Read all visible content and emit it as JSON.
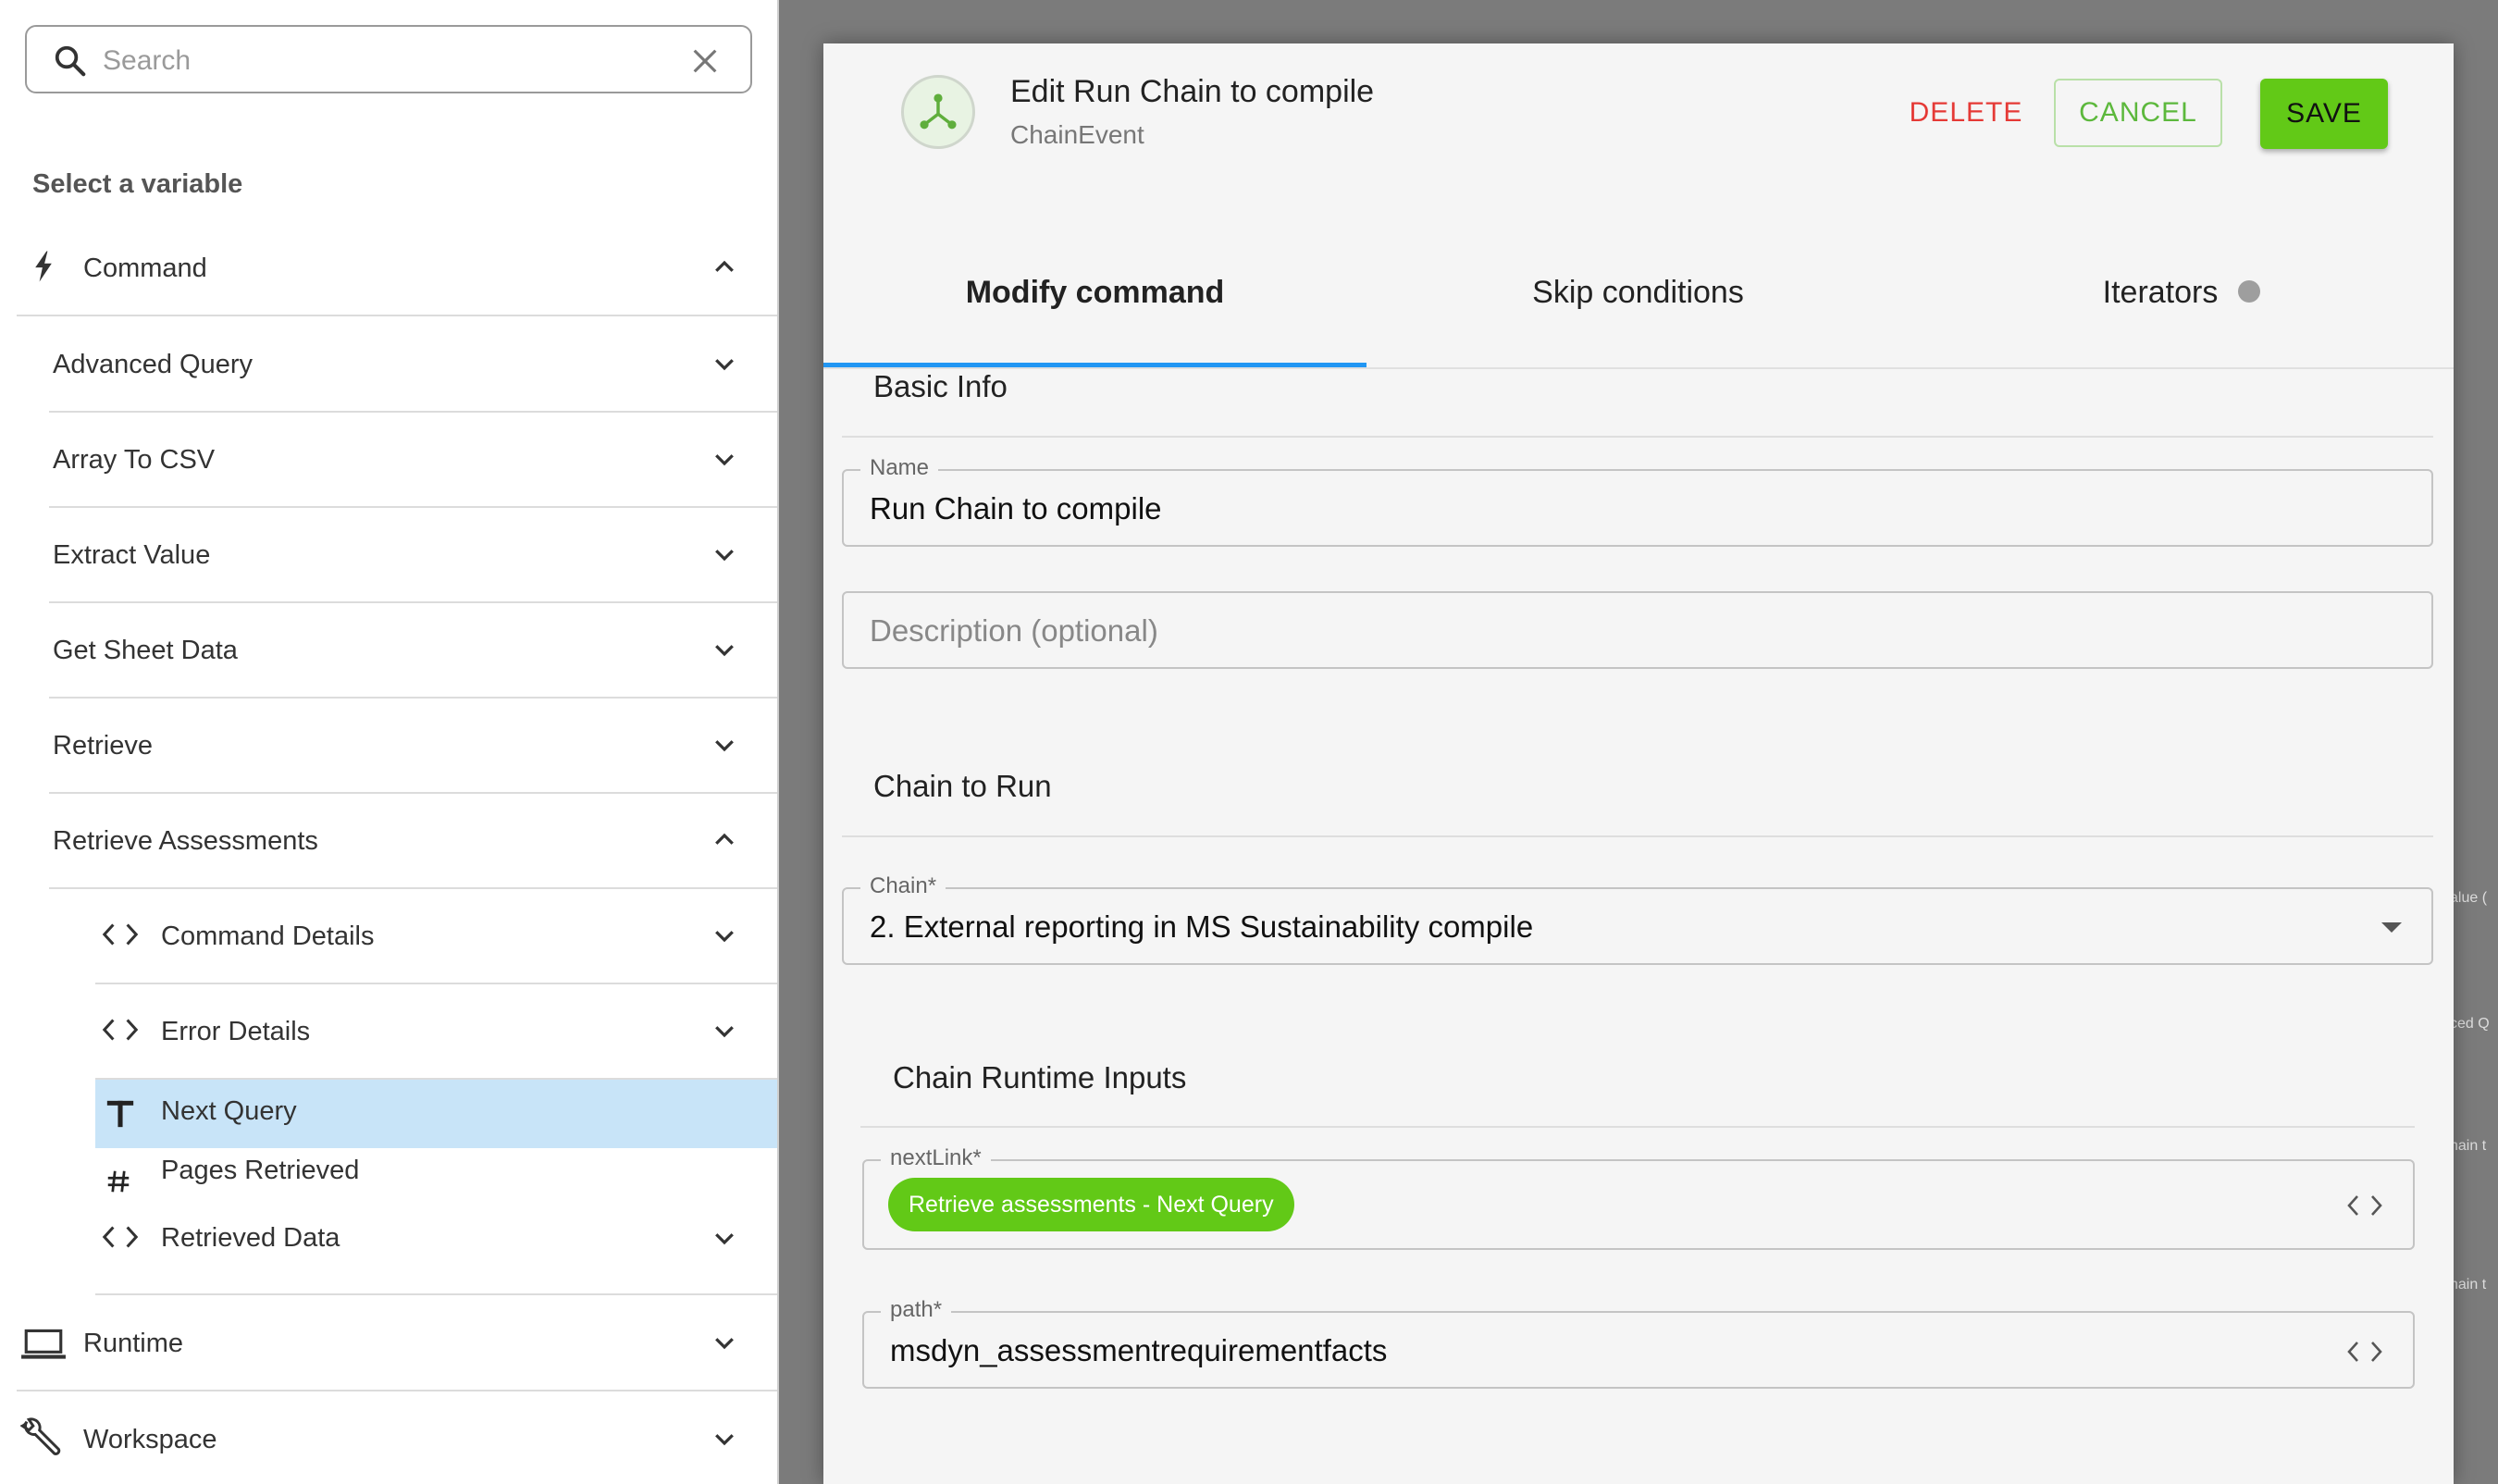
{
  "sidebar": {
    "search": {
      "placeholder": "Search",
      "icon": "search-icon",
      "clear_icon": "close-icon"
    },
    "heading": "Select a variable",
    "groups": [
      {
        "label": "Command",
        "icon": "bolt-icon",
        "expanded": true
      },
      {
        "label": "Advanced Query",
        "expanded": false
      },
      {
        "label": "Array To CSV",
        "expanded": false
      },
      {
        "label": "Extract Value",
        "expanded": false
      },
      {
        "label": "Get Sheet Data",
        "expanded": false
      },
      {
        "label": "Retrieve",
        "expanded": false
      },
      {
        "label": "Retrieve Assessments",
        "expanded": true
      },
      {
        "label": "Runtime",
        "icon": "laptop-icon",
        "expanded": false
      },
      {
        "label": "Workspace",
        "icon": "wrench-icon",
        "expanded": false
      }
    ],
    "children": [
      {
        "label": "Command Details",
        "icon": "code-icon",
        "expandable": true
      },
      {
        "label": "Error Details",
        "icon": "code-icon",
        "expandable": true
      },
      {
        "label": "Next Query",
        "icon": "text-type-icon",
        "selected": true
      },
      {
        "label": "Pages Retrieved",
        "icon": "number-type-icon"
      },
      {
        "label": "Retrieved Data",
        "icon": "code-icon",
        "expandable": true
      }
    ],
    "selected_color": "#c8e4f8"
  },
  "dialog": {
    "title": "Edit Run Chain to compile",
    "subtitle": "ChainEvent",
    "logo_icon": "chain-event-icon",
    "buttons": {
      "delete": "DELETE",
      "cancel": "CANCEL",
      "save": "SAVE"
    },
    "tabs": [
      {
        "label": "Modify command",
        "active": true
      },
      {
        "label": "Skip conditions",
        "active": false
      },
      {
        "label": "Iterators",
        "active": false,
        "status_dot": true
      }
    ],
    "basic_info": {
      "title": "Basic Info",
      "name_label": "Name",
      "name_value": "Run Chain to compile",
      "description_placeholder": "Description (optional)"
    },
    "chain_to_run": {
      "title": "Chain to Run",
      "chain_label": "Chain*",
      "chain_value": "2. External reporting in MS Sustainability compile"
    },
    "runtime_inputs": {
      "title": "Chain Runtime Inputs",
      "nextlink_label": "nextLink*",
      "nextlink_chip": "Retrieve assessments - Next Query",
      "path_label": "path*",
      "path_value": "msdyn_assessmentrequirementfacts"
    }
  },
  "background_peek": [
    "alue (",
    "ced Q",
    "hain t",
    "hain t"
  ],
  "colors": {
    "accent_green": "#62c917",
    "delete_red": "#e53935",
    "tab_ink": "#2196f3"
  }
}
